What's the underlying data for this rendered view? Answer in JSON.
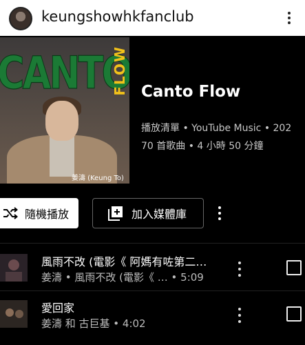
{
  "header": {
    "username": "keungshowhkfanclub",
    "icons": {
      "avatar": "profile-avatar",
      "more": "more-vertical-icon"
    }
  },
  "cover": {
    "title_text": "CANTO",
    "side_text": "FLOW",
    "caption": "姜濤 (Keung To)",
    "colors": {
      "title": "#1b7a35",
      "side": "#f2c21a"
    }
  },
  "playlist": {
    "title": "Canto Flow",
    "meta_line1": "播放清單 • YouTube Music • 202",
    "meta_line2": "70 首歌曲 • 4 小時 50 分鐘"
  },
  "actions": {
    "shuffle_label": "隨機播放",
    "library_label": "加入媒體庫",
    "icons": {
      "shuffle": "shuffle-icon",
      "library": "add-to-library-icon",
      "more": "more-vertical-icon"
    }
  },
  "songs": [
    {
      "title": "風雨不改 (電影《 阿媽有咗第二…",
      "subtitle": "姜濤 • 風雨不改 (電影《 …  • 5:09"
    },
    {
      "title": "愛回家",
      "subtitle": "姜濤 和 古巨基 • 4:02"
    }
  ]
}
